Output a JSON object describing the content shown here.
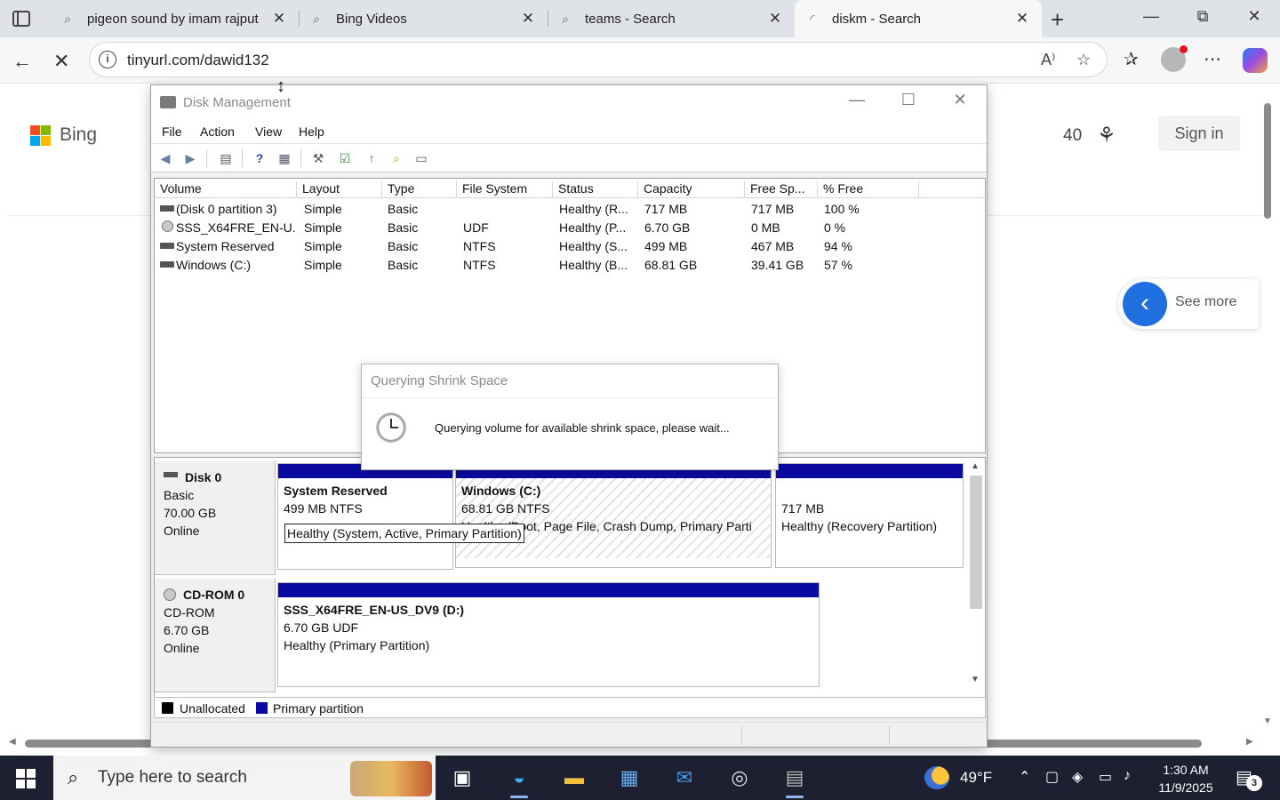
{
  "browser": {
    "tabs": [
      {
        "title": "pigeon sound by imam rajput",
        "close": "✕"
      },
      {
        "title": "Bing Videos",
        "close": "✕"
      },
      {
        "title": "teams - Search",
        "close": "✕"
      },
      {
        "title": "diskm - Search",
        "close": "✕"
      }
    ],
    "url": "tinyurl.com/dawid132"
  },
  "bing": {
    "logo_text": "Bing",
    "rewards_count": "40",
    "sign_in": "Sign in",
    "see_more": "See more"
  },
  "disk_management": {
    "title": "Disk Management",
    "menu": [
      "File",
      "Action",
      "View",
      "Help"
    ],
    "columns": [
      "Volume",
      "Layout",
      "Type",
      "File System",
      "Status",
      "Capacity",
      "Free Sp...",
      "% Free"
    ],
    "volumes": [
      {
        "volume": "(Disk 0 partition 3)",
        "layout": "Simple",
        "type": "Basic",
        "fs": "",
        "status": "Healthy (R...",
        "capacity": "717 MB",
        "free": "717 MB",
        "pct": "100 %"
      },
      {
        "volume": "SSS_X64FRE_EN-U...",
        "layout": "Simple",
        "type": "Basic",
        "fs": "UDF",
        "status": "Healthy (P...",
        "capacity": "6.70 GB",
        "free": "0 MB",
        "pct": "0 %"
      },
      {
        "volume": "System Reserved",
        "layout": "Simple",
        "type": "Basic",
        "fs": "NTFS",
        "status": "Healthy (S...",
        "capacity": "499 MB",
        "free": "467 MB",
        "pct": "94 %"
      },
      {
        "volume": "Windows (C:)",
        "layout": "Simple",
        "type": "Basic",
        "fs": "NTFS",
        "status": "Healthy (B...",
        "capacity": "68.81 GB",
        "free": "39.41 GB",
        "pct": "57 %"
      }
    ],
    "dialog": {
      "title": "Querying Shrink Space",
      "message": "Querying volume for available shrink space, please wait..."
    },
    "disks": [
      {
        "name": "Disk 0",
        "kind": "Basic",
        "size": "70.00 GB",
        "state": "Online"
      },
      {
        "name": "CD-ROM 0",
        "kind": "CD-ROM",
        "size": "6.70 GB",
        "state": "Online"
      }
    ],
    "partitions": {
      "sysres": {
        "name": "System Reserved",
        "size": "499 MB NTFS",
        "status": "Healthy (System, Active, Primary Partition)"
      },
      "windows": {
        "name": "Windows  (C:)",
        "size": "68.81 GB NTFS",
        "status": "Healthy (Boot, Page File, Crash Dump, Primary Parti"
      },
      "recovery": {
        "size": "717 MB",
        "status": "Healthy (Recovery Partition)"
      },
      "cdrom": {
        "name": "SSS_X64FRE_EN-US_DV9  (D:)",
        "size": "6.70 GB UDF",
        "status": "Healthy (Primary Partition)"
      }
    },
    "legend": {
      "unallocated": "Unallocated",
      "primary": "Primary partition",
      "unallocated_color": "#000000",
      "primary_color": "#0a0aa0"
    }
  },
  "taskbar": {
    "search_placeholder": "Type here to search",
    "temperature": "49°F",
    "time": "1:30 AM",
    "date": "11/9/2025",
    "notifications": "3"
  }
}
